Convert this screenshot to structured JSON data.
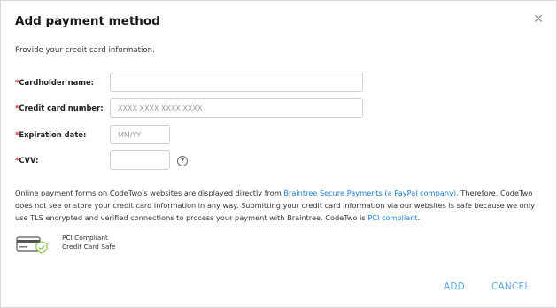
{
  "dialog": {
    "title": "Add payment method",
    "close_glyph": "✕",
    "subtitle": "Provide your credit card information."
  },
  "form": {
    "cardholder": {
      "required_mark": "*",
      "label": "Cardholder name:",
      "value": "",
      "placeholder": ""
    },
    "card_number": {
      "required_mark": "*",
      "label": "Credit card number:",
      "value": "",
      "placeholder": "XXXX XXXX XXXX XXXX"
    },
    "expiration": {
      "required_mark": "*",
      "label": "Expiration date:",
      "value": "",
      "placeholder": "MM/YY"
    },
    "cvv": {
      "required_mark": "*",
      "label": "CVV:",
      "value": "",
      "placeholder": "",
      "help_glyph": "?"
    }
  },
  "notice": {
    "part1": "Online payment forms on CodeTwo's websites are displayed directly from ",
    "link1": "Braintree Secure Payments (a PayPal company)",
    "part2": ". Therefore, CodeTwo does not see or store your credit card information in any way. Submitting your credit card information via our websites is safe because we only use TLS encrypted and verified connections to process your payment with Braintree. CodeTwo is ",
    "link2": "PCI compliant",
    "part3": "."
  },
  "pci_badge": {
    "icon": "credit-card-shield-icon",
    "line1": "PCI Compliant",
    "line2": "Credit Card Safe"
  },
  "actions": {
    "add_label": "ADD",
    "cancel_label": "CANCEL"
  },
  "colors": {
    "accent": "#5ea8e6",
    "link": "#1a7fd4",
    "required": "#d32f2f"
  }
}
